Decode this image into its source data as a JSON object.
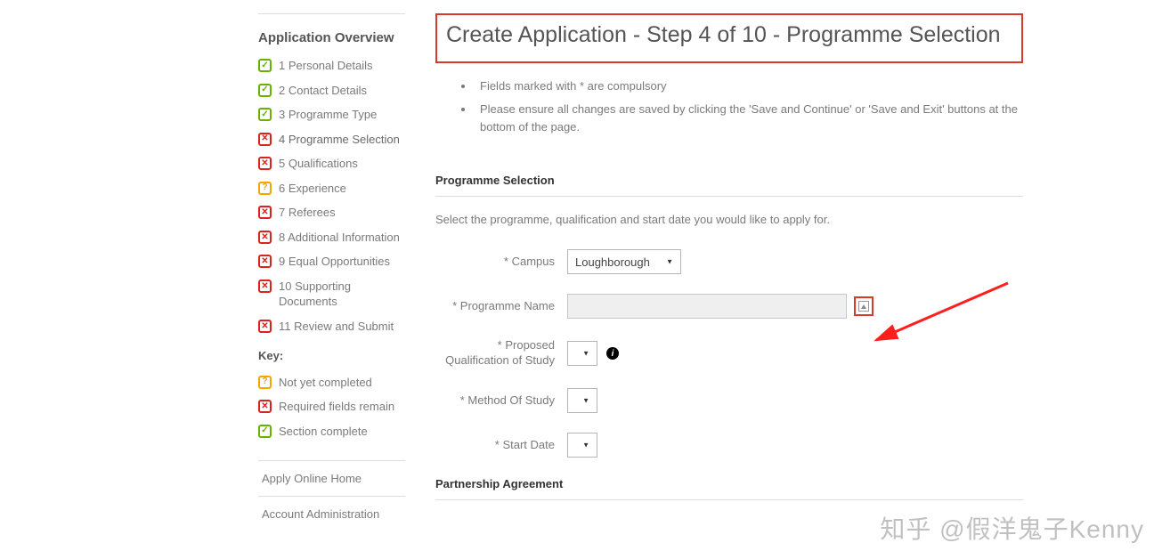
{
  "sidebar": {
    "heading": "Application Overview",
    "steps": [
      {
        "label": "1 Personal Details",
        "status": "complete"
      },
      {
        "label": "2 Contact Details",
        "status": "complete"
      },
      {
        "label": "3 Programme Type",
        "status": "complete"
      },
      {
        "label": "4 Programme Selection",
        "status": "required",
        "current": true
      },
      {
        "label": "5 Qualifications",
        "status": "required"
      },
      {
        "label": "6 Experience",
        "status": "notyet"
      },
      {
        "label": "7 Referees",
        "status": "required"
      },
      {
        "label": "8 Additional Information",
        "status": "required"
      },
      {
        "label": "9 Equal Opportunities",
        "status": "required"
      },
      {
        "label": "10 Supporting Documents",
        "status": "required"
      },
      {
        "label": "11 Review and Submit",
        "status": "required"
      }
    ],
    "key_heading": "Key:",
    "key": [
      {
        "label": "Not yet completed",
        "status": "notyet"
      },
      {
        "label": "Required fields remain",
        "status": "required"
      },
      {
        "label": "Section complete",
        "status": "complete"
      }
    ],
    "links": [
      "Apply Online Home",
      "Account Administration"
    ]
  },
  "main": {
    "title": "Create Application - Step 4 of 10 - Programme Selection",
    "info": [
      "Fields marked with * are compulsory",
      "Please ensure all changes are saved by clicking the 'Save and Continue' or 'Save and Exit' buttons at the bottom of the page."
    ],
    "section_heading": "Programme Selection",
    "section_intro": "Select the programme, qualification and start date you would like to apply for.",
    "fields": {
      "campus": {
        "label": "*  Campus",
        "value": "Loughborough"
      },
      "programme_name": {
        "label": "*  Programme Name",
        "value": ""
      },
      "qualification": {
        "label": "*  Proposed Qualification of Study",
        "value": ""
      },
      "method": {
        "label": "*  Method Of Study",
        "value": ""
      },
      "start_date": {
        "label": "*  Start Date",
        "value": ""
      }
    },
    "section2_heading": "Partnership Agreement"
  },
  "watermark": "知乎 @假洋鬼子Kenny"
}
